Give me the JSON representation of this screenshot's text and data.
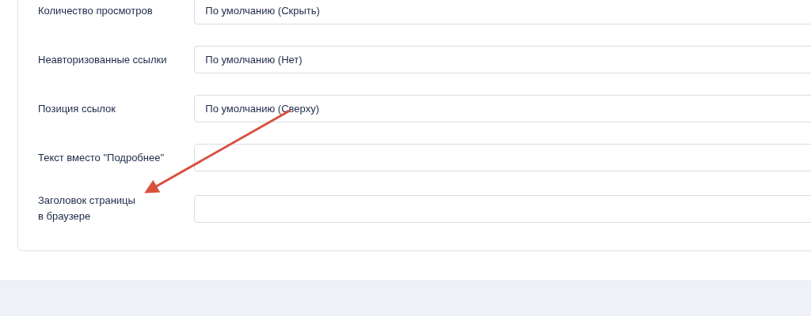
{
  "settings": [
    {
      "label": "Количество просмотров",
      "value": "По умолчанию (Скрыть)"
    },
    {
      "label": "Неавторизованные ссылки",
      "value": "По умолчанию (Нет)"
    },
    {
      "label": "Позиция ссылок",
      "value": "По умолчанию (Сверху)"
    },
    {
      "label": "Текст вместо \"Подробнее\""
    },
    {
      "label": "Заголовок страницы\nв браузере"
    }
  ]
}
